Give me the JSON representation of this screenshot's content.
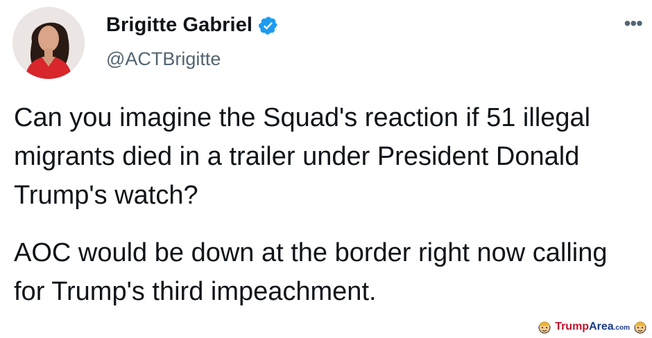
{
  "tweet": {
    "display_name": "Brigitte Gabriel",
    "handle": "@ACTBrigitte",
    "more_icon": "more-icon",
    "verified_icon": "verified-badge-icon",
    "verified_color": "#1d9bf0",
    "paragraphs": [
      "Can you imagine the Squad's reaction if 51 illegal migrants died in a trailer under President Donald Trump's watch?",
      "AOC would be down at the border right now calling for Trump's third impeachment."
    ]
  },
  "watermark": {
    "part1": "Trump",
    "part2": "Area",
    "part3": ".com",
    "color_primary": "#c0122b",
    "color_secondary": "#1a3a8a"
  }
}
